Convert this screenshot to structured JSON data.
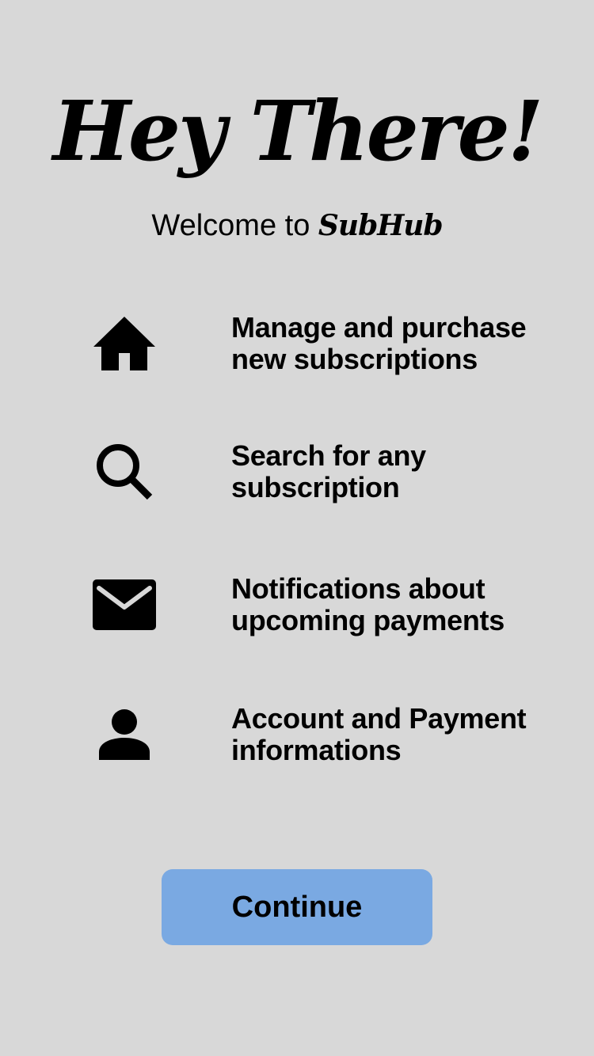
{
  "greeting": {
    "headline": "Hey There!",
    "welcome_prefix": "Welcome to ",
    "brand_name": "SubHub"
  },
  "features": [
    {
      "icon": "home-icon",
      "label": "Manage and purchase new subscriptions"
    },
    {
      "icon": "search-icon",
      "label": "Search for any subscription"
    },
    {
      "icon": "mail-icon",
      "label": "Notifications about upcoming payments"
    },
    {
      "icon": "person-icon",
      "label": "Account and Payment informations"
    }
  ],
  "actions": {
    "continue_label": "Continue"
  },
  "colors": {
    "background": "#d8d8d8",
    "button": "#7aa9e2",
    "text": "#000000"
  }
}
